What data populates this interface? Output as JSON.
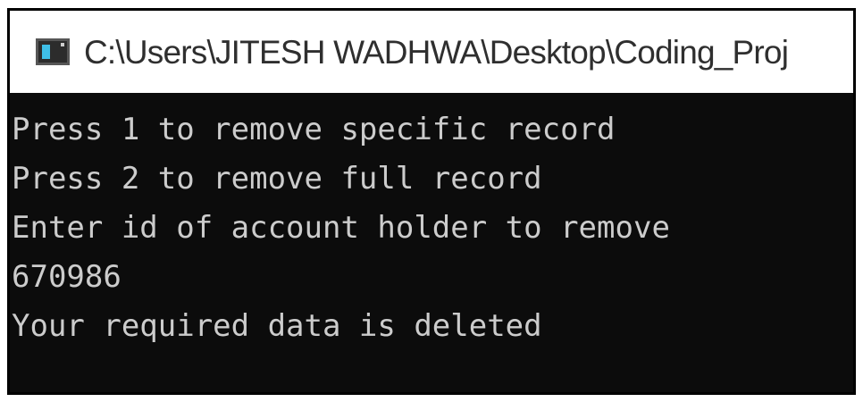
{
  "window": {
    "title": "C:\\Users\\JITESH WADHWA\\Desktop\\Coding_Proj",
    "icon": "console-window-icon"
  },
  "console": {
    "lines": [
      "Press 1 to remove specific record",
      "Press 2 to remove full record",
      "Enter id of account holder to remove",
      "670986",
      "Your required data is deleted"
    ],
    "colors": {
      "background": "#0c0c0c",
      "text": "#cccccc"
    }
  }
}
